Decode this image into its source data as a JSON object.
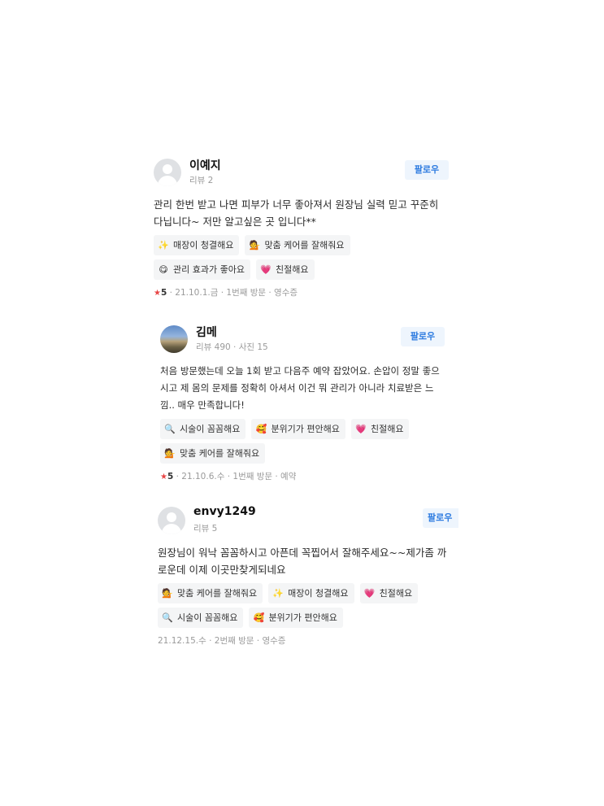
{
  "follow_label": "팔로우",
  "reviews": [
    {
      "name": "이예지",
      "meta": "리뷰 2",
      "body": "관리 한번 받고 나면 피부가 너무 좋아져서 원장님 실력 믿고 꾸준히 다닙니다~ 저만 알고싶은 곳 입니다**",
      "tags": [
        {
          "emoji": "✨",
          "label": "매장이 청결해요"
        },
        {
          "emoji": "💁",
          "label": "맞춤 케어를 잘해줘요"
        },
        {
          "emoji": "😋",
          "label": "관리 효과가 좋아요"
        },
        {
          "emoji": "💗",
          "label": "친절해요"
        }
      ],
      "rating": "5",
      "foot": "· 21.10.1.금 · 1번째 방문 · 영수증"
    },
    {
      "name": "김메",
      "meta": "리뷰 490 · 사진 15",
      "body": "처음 방문했는데 오늘 1회 받고 다음주 예약 잡았어요. 손압이 정말 좋으시고 제 몸의 문제를 정확히 아셔서 이건 뭐 관리가 아니라 치료받은 느낌.. 매우 만족합니다!",
      "tags": [
        {
          "emoji": "🔍",
          "label": "시술이 꼼꼼해요"
        },
        {
          "emoji": "🥰",
          "label": "분위기가 편안해요"
        },
        {
          "emoji": "💗",
          "label": "친절해요"
        },
        {
          "emoji": "💁",
          "label": "맞춤 케어를 잘해줘요"
        }
      ],
      "rating": "5",
      "foot": "· 21.10.6.수 · 1번째 방문 · 예약"
    },
    {
      "name": "envy1249",
      "meta": "리뷰 5",
      "body": "원장님이 워낙 꼼꼼하시고 아픈데 꼭찝어서 잘해주세요~~제가좀 까로운데 이제 이곳만찾게되네요",
      "tags": [
        {
          "emoji": "💁",
          "label": "맞춤 케어를 잘해줘요"
        },
        {
          "emoji": "✨",
          "label": "매장이 청결해요"
        },
        {
          "emoji": "💗",
          "label": "친절해요"
        },
        {
          "emoji": "🔍",
          "label": "시술이 꼼꼼해요"
        },
        {
          "emoji": "🥰",
          "label": "분위기가 편안해요"
        }
      ],
      "foot": "21.12.15.수 · 2번째 방문 · 영수증"
    }
  ]
}
